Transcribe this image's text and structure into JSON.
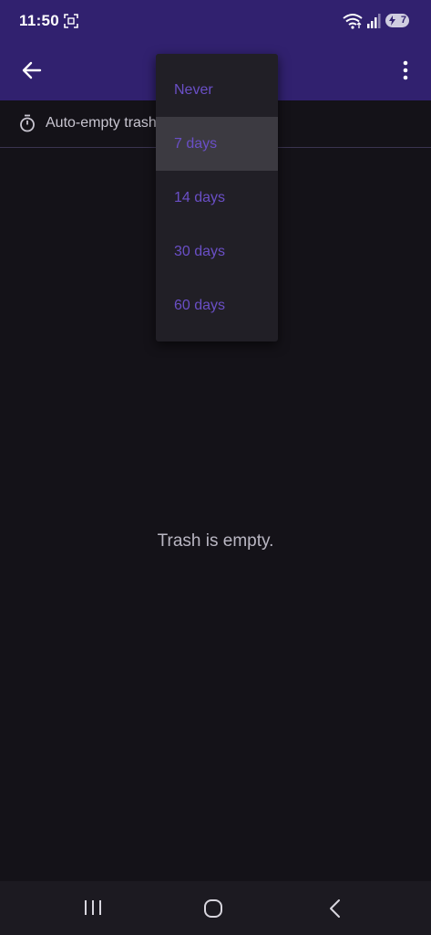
{
  "status_bar": {
    "time": "11:50",
    "battery_level": "7",
    "icons": [
      "screenshot-icon",
      "wifi-icon",
      "signal-icon",
      "battery-charging-icon"
    ]
  },
  "app_bar": {
    "back_icon": "arrow-back-icon",
    "more_icon": "more-vert-icon"
  },
  "settings_row": {
    "icon": "timer-icon",
    "label": "Auto-empty trash"
  },
  "dropdown": {
    "options": [
      "Never",
      "7 days",
      "14 days",
      "30 days",
      "60 days"
    ],
    "selected": "7 days"
  },
  "main": {
    "empty_message": "Trash is empty."
  },
  "nav_bar": {
    "icons": [
      "recent-apps-icon",
      "home-icon",
      "nav-back-icon"
    ]
  },
  "colors": {
    "app_bar": "#31216f",
    "background": "#141218",
    "menu_background": "#211f26",
    "menu_selected": "#3c3a41",
    "menu_text": "#6a4fc6",
    "nav_bar": "#1c1a21"
  }
}
